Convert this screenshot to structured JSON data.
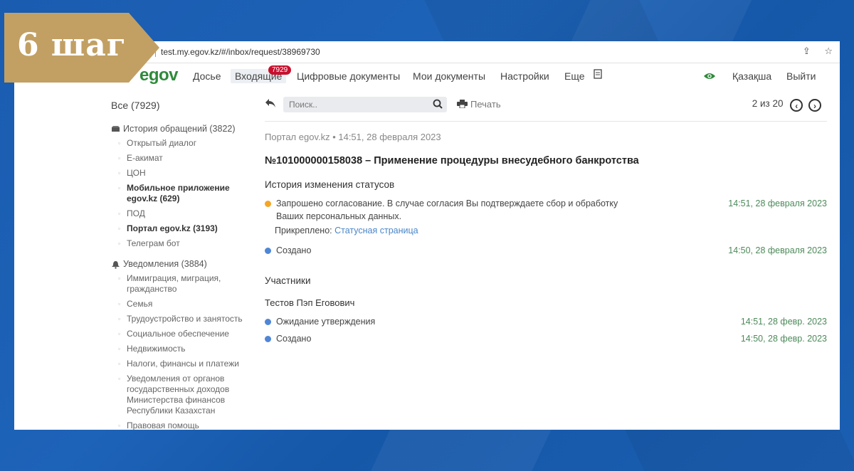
{
  "step_badge": "6 шаг",
  "browser": {
    "url": "test.my.egov.kz/#/inbox/request/38969730",
    "icons": [
      "share-icon",
      "star-icon"
    ]
  },
  "nav": {
    "logo": "egov",
    "items": [
      "Досье",
      "Входящие",
      "Цифровые документы",
      "Мои документы",
      "Настройки",
      "Еще"
    ],
    "inbox_badge": "7929",
    "language": "Қазақша",
    "logout": "Выйти"
  },
  "sidebar": {
    "all": "Все (7929)",
    "history_head": "История обращений (3822)",
    "history_items": [
      "Открытый диалог",
      "Е-акимат",
      "ЦОН",
      "Мобильное приложение egov.kz (629)",
      "ПОД",
      "Портал egov.kz (3193)",
      "Телеграм бот"
    ],
    "notif_head": "Уведомления (3884)",
    "notif_items": [
      "Иммиграция, миграция, гражданство",
      "Семья",
      "Трудоустройство и занятость",
      "Социальное обеспечение",
      "Недвижимость",
      "Налоги, финансы и платежи",
      "Уведомления от органов государственных доходов Министерства финансов Республики Казахстан",
      "Правовая помощь"
    ]
  },
  "toolbar": {
    "search_placeholder": "Поиск..",
    "print": "Печать",
    "pager": "2 из 20"
  },
  "message": {
    "source": "Портал egov.kz • 14:51, 28 февраля 2023",
    "title": "№101000000158038 – Применение процедуры внесудебного банкротства",
    "history_title": "История изменения статусов",
    "status1_line1": "Запрошено согласование. В случае согласия Вы подтверждаете сбор и обработку",
    "status1_line2": "Ваших персональных данных.",
    "status1_time": "14:51, 28 февраля 2023",
    "attach_label": "Прикреплено:",
    "attach_link": "Статусная страница",
    "status2": "Создано",
    "status2_time": "14:50, 28 февраля 2023",
    "participants_title": "Участники",
    "participant_name": "Тестов Пэп Еговович",
    "p_status1": "Ожидание утверждения",
    "p_status1_time": "14:51, 28 февр. 2023",
    "p_status2": "Создано",
    "p_status2_time": "14:50, 28 февр. 2023"
  },
  "colors": {
    "logo_green": "#2f8a3b",
    "badge_red": "#c8102e",
    "step_gold": "#c2a063",
    "time_green": "#4d8a5a",
    "link_blue": "#4a86c8"
  }
}
